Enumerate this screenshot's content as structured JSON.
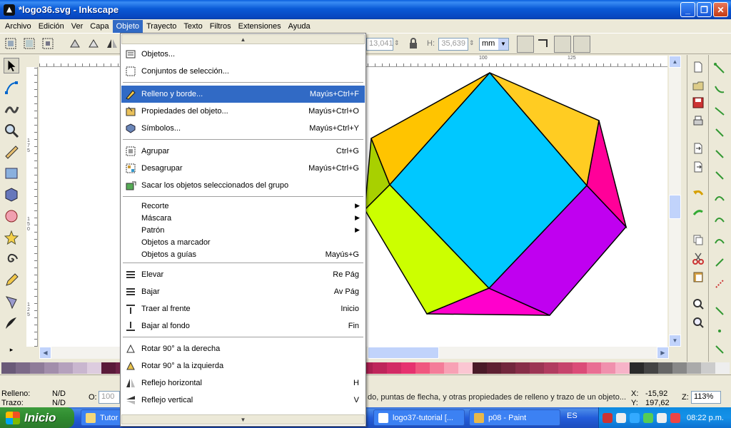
{
  "window": {
    "title": "*logo36.svg - Inkscape",
    "controls": [
      "minimize-icon",
      "maximize-icon",
      "close-icon"
    ]
  },
  "menubar": [
    "Archivo",
    "Edición",
    "Ver",
    "Capa",
    "Objeto",
    "Trayecto",
    "Texto",
    "Filtros",
    "Extensiones",
    "Ayuda"
  ],
  "menubar_active": "Objeto",
  "toolbar": {
    "y_value": "13,041",
    "h_label": "H:",
    "h_value": "35,639",
    "unit": "mm"
  },
  "ruler": {
    "top_labels": [
      "100",
      "125"
    ],
    "left_labels": [
      "175",
      "150",
      "125"
    ]
  },
  "object_menu": [
    {
      "type": "item",
      "label": "Objetos...",
      "accel": "",
      "icon": "objects-icon"
    },
    {
      "type": "item",
      "label": "Conjuntos de selección...",
      "accel": "",
      "icon": "selection-sets-icon"
    },
    {
      "type": "sep"
    },
    {
      "type": "item",
      "label": "Relleno y borde...",
      "accel": "Mayús+Ctrl+F",
      "icon": "fill-stroke-icon",
      "highlighted": true
    },
    {
      "type": "item",
      "label": "Propiedades del objeto...",
      "accel": "Mayús+Ctrl+O",
      "icon": "object-properties-icon"
    },
    {
      "type": "item",
      "label": "Símbolos...",
      "accel": "Mayús+Ctrl+Y",
      "icon": "symbols-icon"
    },
    {
      "type": "sep"
    },
    {
      "type": "item",
      "label": "Agrupar",
      "accel": "Ctrl+G",
      "icon": "group-icon"
    },
    {
      "type": "item",
      "label": "Desagrupar",
      "accel": "Mayús+Ctrl+G",
      "icon": "ungroup-icon"
    },
    {
      "type": "item",
      "label": "Sacar los objetos seleccionados del grupo",
      "accel": "",
      "icon": "pop-from-group-icon"
    },
    {
      "type": "sep"
    },
    {
      "type": "submenu",
      "label": "Recorte"
    },
    {
      "type": "submenu",
      "label": "Máscara"
    },
    {
      "type": "submenu",
      "label": "Patrón"
    },
    {
      "type": "text",
      "label": "Objetos a marcador",
      "accel": ""
    },
    {
      "type": "text",
      "label": "Objetos a guías",
      "accel": "Mayús+G"
    },
    {
      "type": "sep"
    },
    {
      "type": "item",
      "label": "Elevar",
      "accel": "Re Pág",
      "icon": "raise-icon"
    },
    {
      "type": "item",
      "label": "Bajar",
      "accel": "Av Pág",
      "icon": "lower-icon"
    },
    {
      "type": "item",
      "label": "Traer al frente",
      "accel": "Inicio",
      "icon": "raise-to-top-icon"
    },
    {
      "type": "item",
      "label": "Bajar al fondo",
      "accel": "Fin",
      "icon": "lower-to-bottom-icon"
    },
    {
      "type": "sep"
    },
    {
      "type": "item",
      "label": "Rotar 90° a la derecha",
      "accel": "",
      "icon": "rotate-cw-icon"
    },
    {
      "type": "item",
      "label": "Rotar 90° a la izquierda",
      "accel": "",
      "icon": "rotate-ccw-icon"
    },
    {
      "type": "item",
      "label": "Reflejo horizontal",
      "accel": "H",
      "icon": "flip-horizontal-icon"
    },
    {
      "type": "item",
      "label": "Reflejo vertical",
      "accel": "V",
      "icon": "flip-vertical-icon"
    }
  ],
  "palette_colors": [
    "#6a5a78",
    "#7c6a88",
    "#8f7c99",
    "#a28eab",
    "#b5a1bd",
    "#c9b6cf",
    "#ddccdf",
    "#5a1a3a",
    "#6e2247",
    "#822a55",
    "#963363",
    "#aa3c72",
    "#be4682",
    "#d25193",
    "#8b1a5a",
    "#9e1f66",
    "#b22573",
    "#c52b80",
    "#d9328d",
    "#ec3a9b",
    "#f66fb4",
    "#5a0f2a",
    "#6e1233",
    "#82163c",
    "#961a46",
    "#aa1f50",
    "#be255a",
    "#d22b65",
    "#e6326f",
    "#f0577f",
    "#f47c99",
    "#f8a1b5",
    "#fbc6d2",
    "#4a1a28",
    "#5e2032",
    "#72273d",
    "#872e48",
    "#9c3554",
    "#b13c60",
    "#c6446c",
    "#db4c78",
    "#e96e93",
    "#f090ad",
    "#f7b3c8",
    "#2a2a2a",
    "#444",
    "#666",
    "#888",
    "#aaa",
    "#ccc",
    "#eee"
  ],
  "statusbar": {
    "fill_label": "Relleno:",
    "fill_value": "N/D",
    "stroke_label": "Trazo:",
    "stroke_value": "N/D",
    "opacity_label": "O:",
    "opacity_value": "100",
    "message": "do, puntas de flecha, y otras propiedades de relleno y trazo de un objeto...",
    "x_label": "X:",
    "x_value": "-15,92",
    "y_label": "Y:",
    "y_value": "197,62",
    "zoom_label": "Z:",
    "zoom_value": "113%"
  },
  "taskbar": {
    "start_label": "Inicio",
    "tasks": [
      "Tutor",
      "logo37-tutorial [...",
      "p08 - Paint"
    ],
    "language": "ES",
    "clock": "08:22 p.m."
  }
}
